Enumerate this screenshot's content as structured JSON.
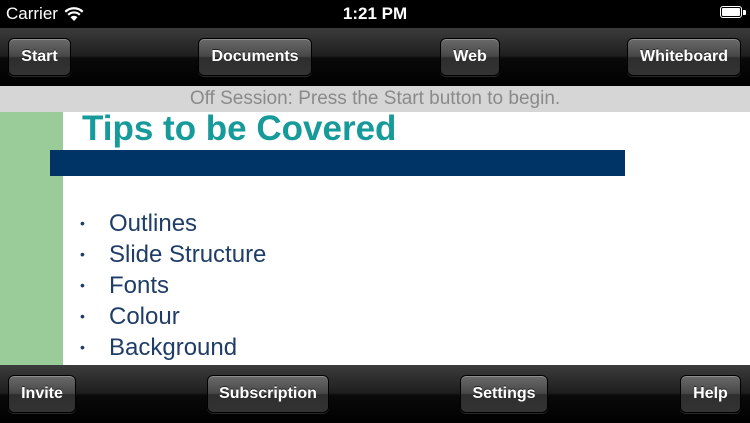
{
  "status_bar": {
    "carrier": "Carrier",
    "time": "1:21 PM",
    "battery_level": 1.0
  },
  "top_toolbar": {
    "start": "Start",
    "documents": "Documents",
    "web": "Web",
    "whiteboard": "Whiteboard"
  },
  "notice": "Off Session: Press the Start button to begin.",
  "slide": {
    "title": "Tips to be Covered",
    "bullet_symbol": "•",
    "items": [
      "Outlines",
      "Slide Structure",
      "Fonts",
      "Colour",
      "Background"
    ]
  },
  "bottom_toolbar": {
    "invite": "Invite",
    "subscription": "Subscription",
    "settings": "Settings",
    "help": "Help"
  },
  "colors": {
    "title": "#179a9a",
    "title_bar": "#003366",
    "sidebar": "#99cc99",
    "bullet_text": "#1f3d66",
    "notice_bg": "#d6d6d6",
    "notice_text": "#8a8a8a"
  }
}
